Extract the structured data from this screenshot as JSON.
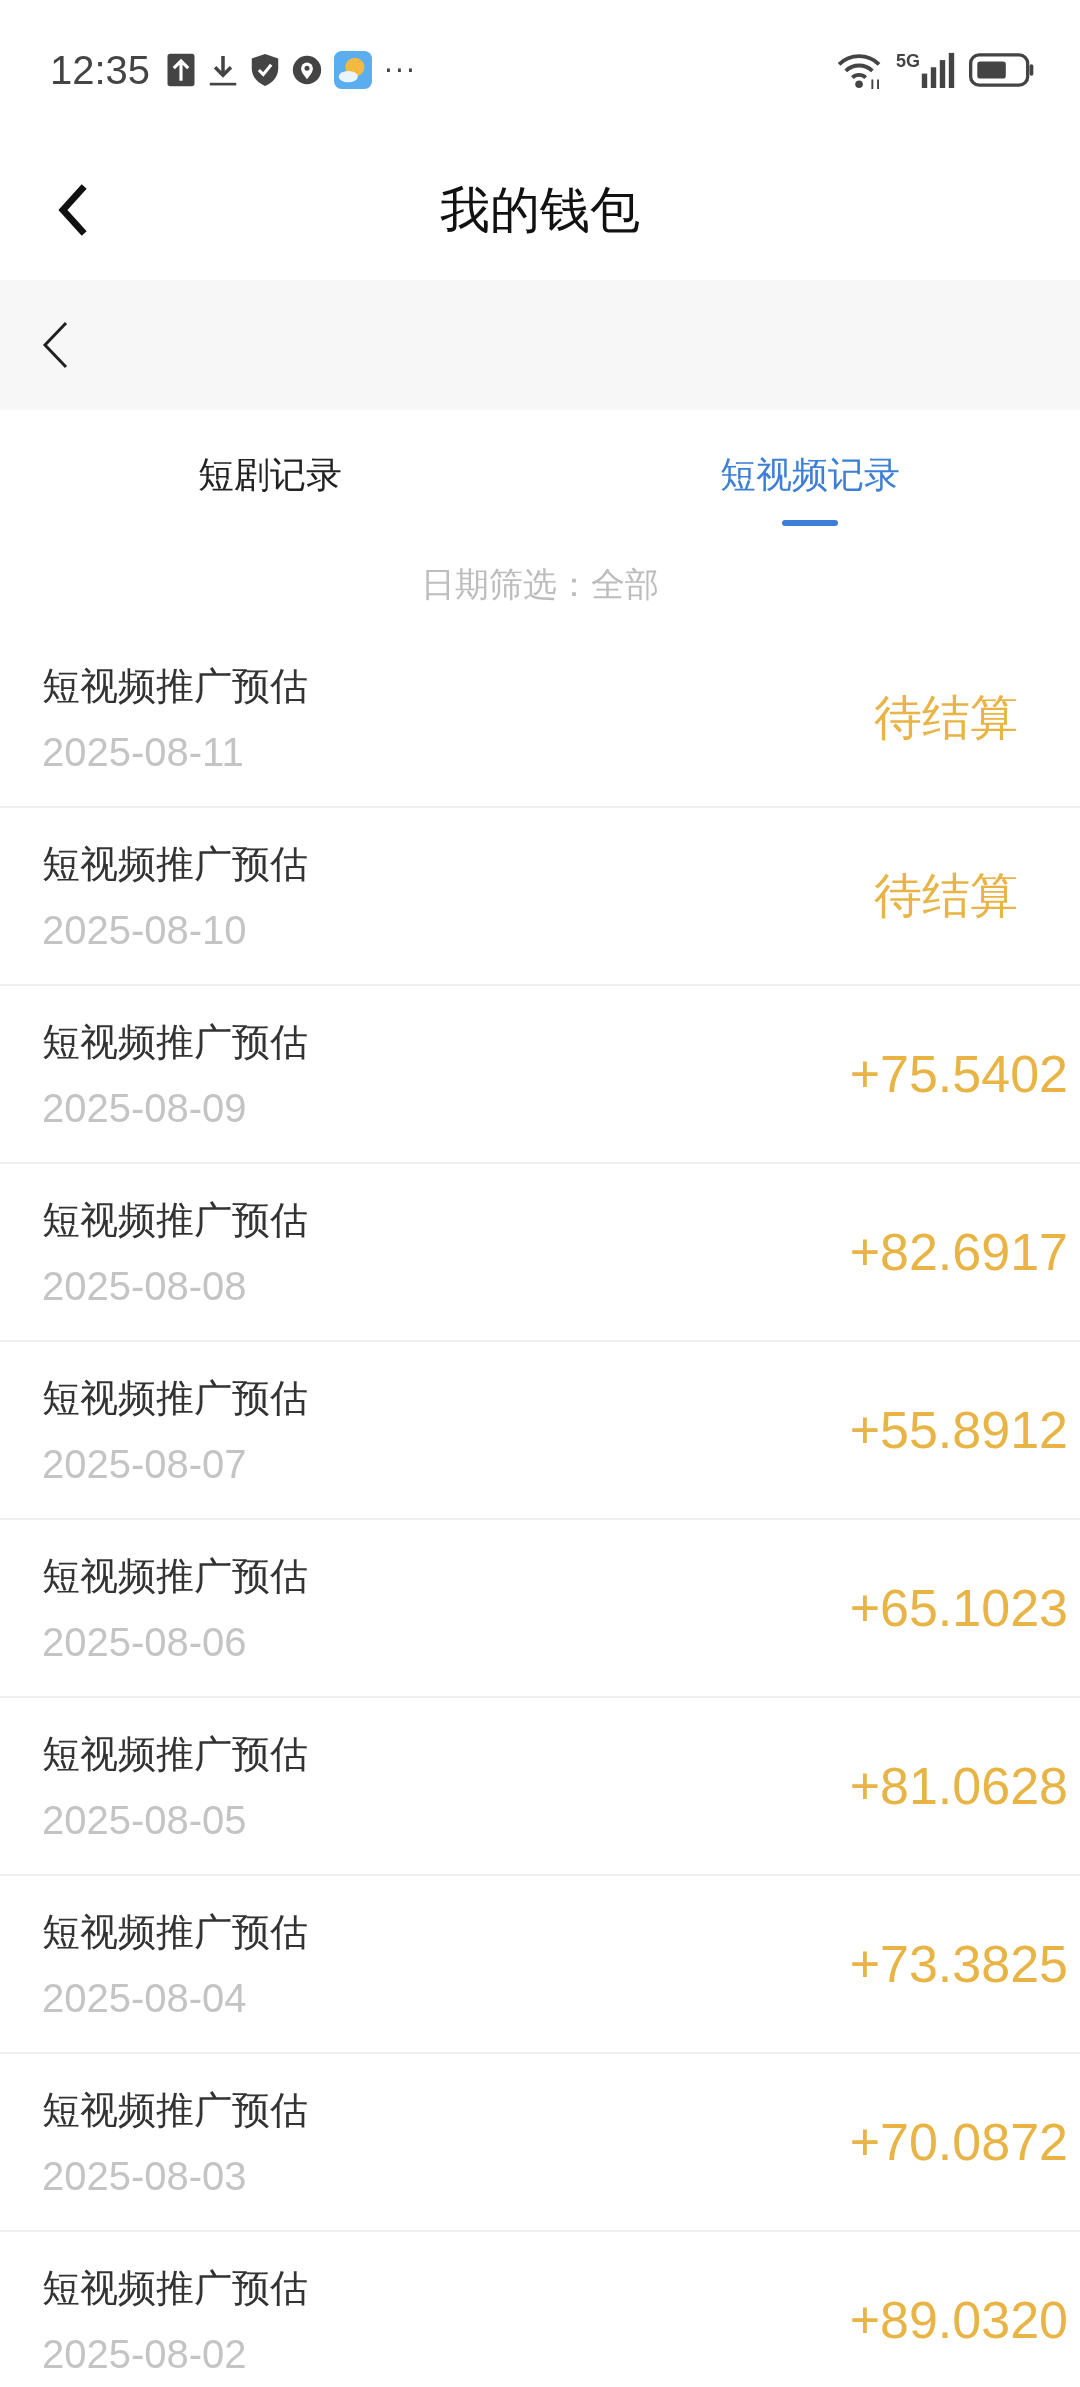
{
  "status_bar": {
    "time": "12:35",
    "more": "···",
    "network": "5G"
  },
  "header": {
    "title": "我的钱包"
  },
  "tabs": [
    {
      "label": "短剧记录",
      "selected": false
    },
    {
      "label": "短视频记录",
      "selected": true
    }
  ],
  "filter": {
    "label": "日期筛选：",
    "value": "全部"
  },
  "records": [
    {
      "title": "短视频推广预估",
      "date": "2025-08-11",
      "amount": "待结算",
      "kind": "pending"
    },
    {
      "title": "短视频推广预估",
      "date": "2025-08-10",
      "amount": "待结算",
      "kind": "pending"
    },
    {
      "title": "短视频推广预估",
      "date": "2025-08-09",
      "amount": "+75.5402",
      "kind": "credit"
    },
    {
      "title": "短视频推广预估",
      "date": "2025-08-08",
      "amount": "+82.6917",
      "kind": "credit"
    },
    {
      "title": "短视频推广预估",
      "date": "2025-08-07",
      "amount": "+55.8912",
      "kind": "credit"
    },
    {
      "title": "短视频推广预估",
      "date": "2025-08-06",
      "amount": "+65.1023",
      "kind": "credit"
    },
    {
      "title": "短视频推广预估",
      "date": "2025-08-05",
      "amount": "+81.0628",
      "kind": "credit"
    },
    {
      "title": "短视频推广预估",
      "date": "2025-08-04",
      "amount": "+73.3825",
      "kind": "credit"
    },
    {
      "title": "短视频推广预估",
      "date": "2025-08-03",
      "amount": "+70.0872",
      "kind": "credit"
    },
    {
      "title": "短视频推广预估",
      "date": "2025-08-02",
      "amount": "+89.0320",
      "kind": "credit"
    }
  ]
}
